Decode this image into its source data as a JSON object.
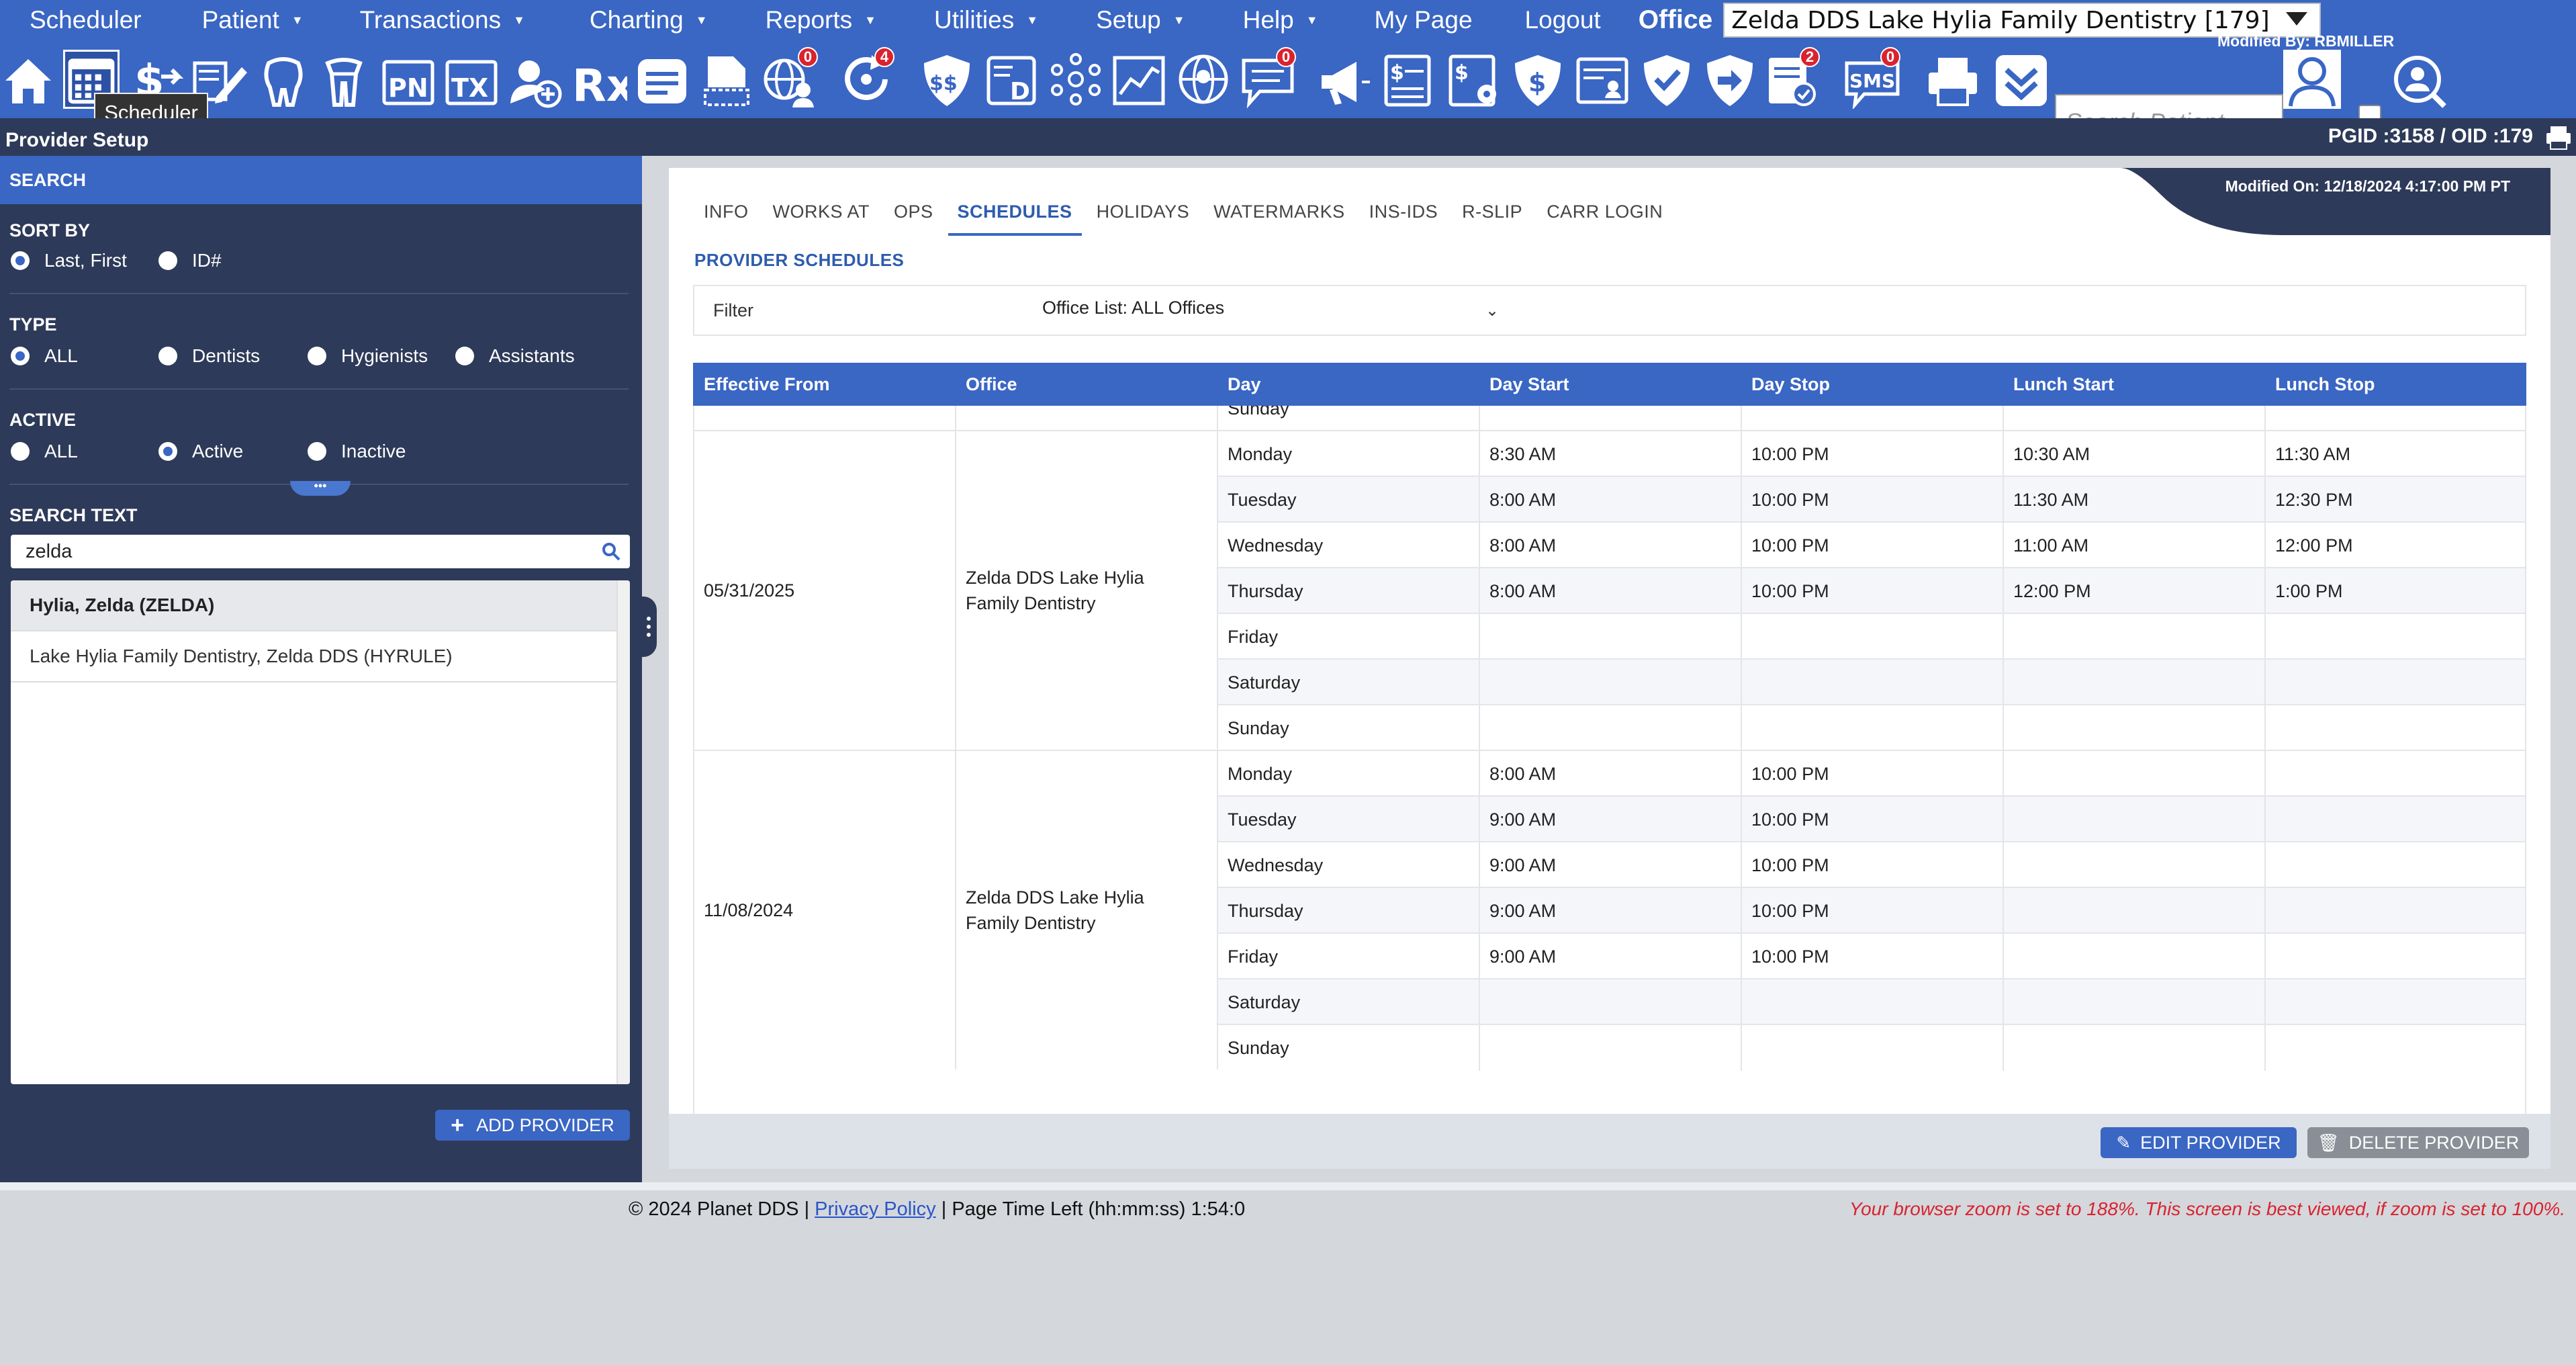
{
  "menu": {
    "items": [
      {
        "label": "Scheduler",
        "caret": false
      },
      {
        "label": "Patient",
        "caret": true
      },
      {
        "label": "Transactions",
        "caret": true
      },
      {
        "label": "Charting",
        "caret": true
      },
      {
        "label": "Reports",
        "caret": true
      },
      {
        "label": "Utilities",
        "caret": true
      },
      {
        "label": "Setup",
        "caret": true
      },
      {
        "label": "Help",
        "caret": true
      },
      {
        "label": "My Page",
        "caret": false
      },
      {
        "label": "Logout",
        "caret": false
      }
    ],
    "office_label": "Office",
    "office_value": "Zelda DDS Lake Hylia Family Dentistry [179]"
  },
  "toolbar": {
    "tooltip": "Scheduler",
    "search_placeholder": "Search Patient...",
    "badges": {
      "globe": "0",
      "refresh": "4",
      "chat": "0",
      "tasks": "2",
      "sms": "0"
    },
    "pn_label": "PN",
    "tx_label": "TX",
    "rx_label": "Rx",
    "sms_label": "SMS",
    "d_label": "D"
  },
  "subheader": {
    "title": "Provider Setup",
    "ids": "PGID :3158  /  OID :179"
  },
  "search_panel": {
    "header": "SEARCH",
    "sort_by": {
      "title": "SORT BY",
      "options": [
        "Last, First",
        "ID#"
      ],
      "selected": 0
    },
    "type": {
      "title": "TYPE",
      "options": [
        "ALL",
        "Dentists",
        "Hygienists",
        "Assistants"
      ],
      "selected": 0
    },
    "active": {
      "title": "ACTIVE",
      "options": [
        "ALL",
        "Active",
        "Inactive"
      ],
      "selected": 1
    },
    "collapse_glyph": "•••",
    "search_text": {
      "title": "SEARCH TEXT",
      "value": "zelda"
    },
    "results": [
      {
        "label": "Hylia, Zelda (ZELDA)",
        "selected": true
      },
      {
        "label": "Lake Hylia Family Dentistry, Zelda DDS (HYRULE)",
        "selected": false
      }
    ],
    "add_button": "ADD PROVIDER"
  },
  "detail": {
    "modified_on": "Modified On: 12/18/2024 4:17:00 PM PT",
    "modified_by": "Modified By: RBMILLER",
    "tabs": [
      "INFO",
      "WORKS AT",
      "OPS",
      "SCHEDULES",
      "HOLIDAYS",
      "WATERMARKS",
      "INS-IDS",
      "R-SLIP",
      "CARR LOGIN"
    ],
    "active_tab": 3,
    "section_title": "PROVIDER SCHEDULES",
    "filter": {
      "label": "Filter",
      "value": "Office List: ALL Offices"
    },
    "columns": [
      "Effective From",
      "Office",
      "Day",
      "Day Start",
      "Day Stop",
      "Lunch Start",
      "Lunch Stop"
    ],
    "partial_group": {
      "rows": [
        {
          "day": "Sunday",
          "day_start": "",
          "day_stop": "",
          "lunch_start": "",
          "lunch_stop": ""
        }
      ]
    },
    "groups": [
      {
        "effective_from": "05/31/2025",
        "office": "Zelda DDS Lake Hylia Family Dentistry",
        "rows": [
          {
            "day": "Monday",
            "day_start": "8:30 AM",
            "day_stop": "10:00 PM",
            "lunch_start": "10:30 AM",
            "lunch_stop": "11:30 AM"
          },
          {
            "day": "Tuesday",
            "day_start": "8:00 AM",
            "day_stop": "10:00 PM",
            "lunch_start": "11:30 AM",
            "lunch_stop": "12:30 PM"
          },
          {
            "day": "Wednesday",
            "day_start": "8:00 AM",
            "day_stop": "10:00 PM",
            "lunch_start": "11:00 AM",
            "lunch_stop": "12:00 PM"
          },
          {
            "day": "Thursday",
            "day_start": "8:00 AM",
            "day_stop": "10:00 PM",
            "lunch_start": "12:00 PM",
            "lunch_stop": "1:00 PM"
          },
          {
            "day": "Friday",
            "day_start": "",
            "day_stop": "",
            "lunch_start": "",
            "lunch_stop": ""
          },
          {
            "day": "Saturday",
            "day_start": "",
            "day_stop": "",
            "lunch_start": "",
            "lunch_stop": ""
          },
          {
            "day": "Sunday",
            "day_start": "",
            "day_stop": "",
            "lunch_start": "",
            "lunch_stop": ""
          }
        ]
      },
      {
        "effective_from": "11/08/2024",
        "office": "Zelda DDS Lake Hylia Family Dentistry",
        "rows": [
          {
            "day": "Monday",
            "day_start": "8:00 AM",
            "day_stop": "10:00 PM",
            "lunch_start": "",
            "lunch_stop": ""
          },
          {
            "day": "Tuesday",
            "day_start": "9:00 AM",
            "day_stop": "10:00 PM",
            "lunch_start": "",
            "lunch_stop": ""
          },
          {
            "day": "Wednesday",
            "day_start": "9:00 AM",
            "day_stop": "10:00 PM",
            "lunch_start": "",
            "lunch_stop": ""
          },
          {
            "day": "Thursday",
            "day_start": "9:00 AM",
            "day_stop": "10:00 PM",
            "lunch_start": "",
            "lunch_stop": ""
          },
          {
            "day": "Friday",
            "day_start": "9:00 AM",
            "day_stop": "10:00 PM",
            "lunch_start": "",
            "lunch_stop": ""
          },
          {
            "day": "Saturday",
            "day_start": "",
            "day_stop": "",
            "lunch_start": "",
            "lunch_stop": ""
          },
          {
            "day": "Sunday",
            "day_start": "",
            "day_stop": "",
            "lunch_start": "",
            "lunch_stop": ""
          }
        ]
      }
    ],
    "edit_button": "EDIT PROVIDER",
    "delete_button": "DELETE PROVIDER"
  },
  "footer": {
    "copyright": "© 2024 Planet DDS |",
    "privacy": "Privacy Policy",
    "time_left": "| Page Time Left (hh:mm:ss) 1:54:0",
    "zoom_warning": "Your browser zoom is set to 188%. This screen is best viewed, if zoom is set to 100%."
  },
  "colors": {
    "brand_blue": "#3a66c4",
    "navy": "#2e3a59",
    "badge_red": "#d9232e"
  }
}
